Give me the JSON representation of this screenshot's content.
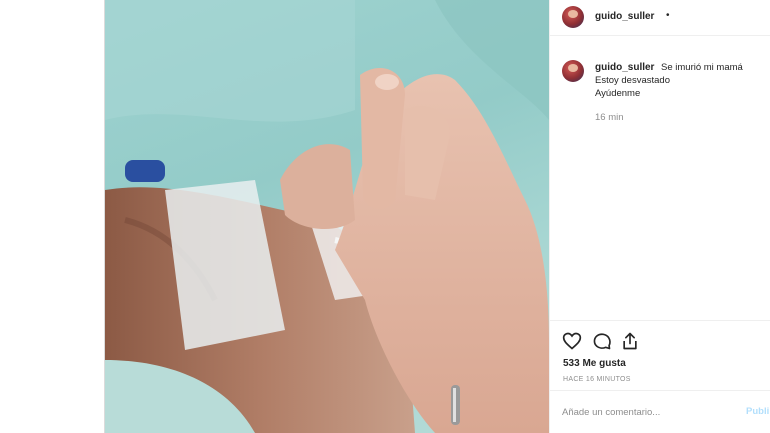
{
  "post": {
    "username": "guido_suller",
    "header_separator": "•",
    "caption_lines": [
      "Se imurió mi mamá",
      "Estoy desvastado",
      "Ayúdenme"
    ],
    "caption_time": "16 min",
    "likes": "533 Me gusta",
    "time_ago": "HACE 16 MINUTOS",
    "comment_placeholder": "Añade un comentario...",
    "publish_label": "Publi"
  },
  "icons": [
    "heart-icon",
    "comment-icon",
    "share-icon"
  ],
  "colors": {
    "border": "#dbdbdb",
    "muted": "#8e8e8e",
    "publish": "#b2dffc",
    "photo_bg": "#9fd3d0"
  }
}
